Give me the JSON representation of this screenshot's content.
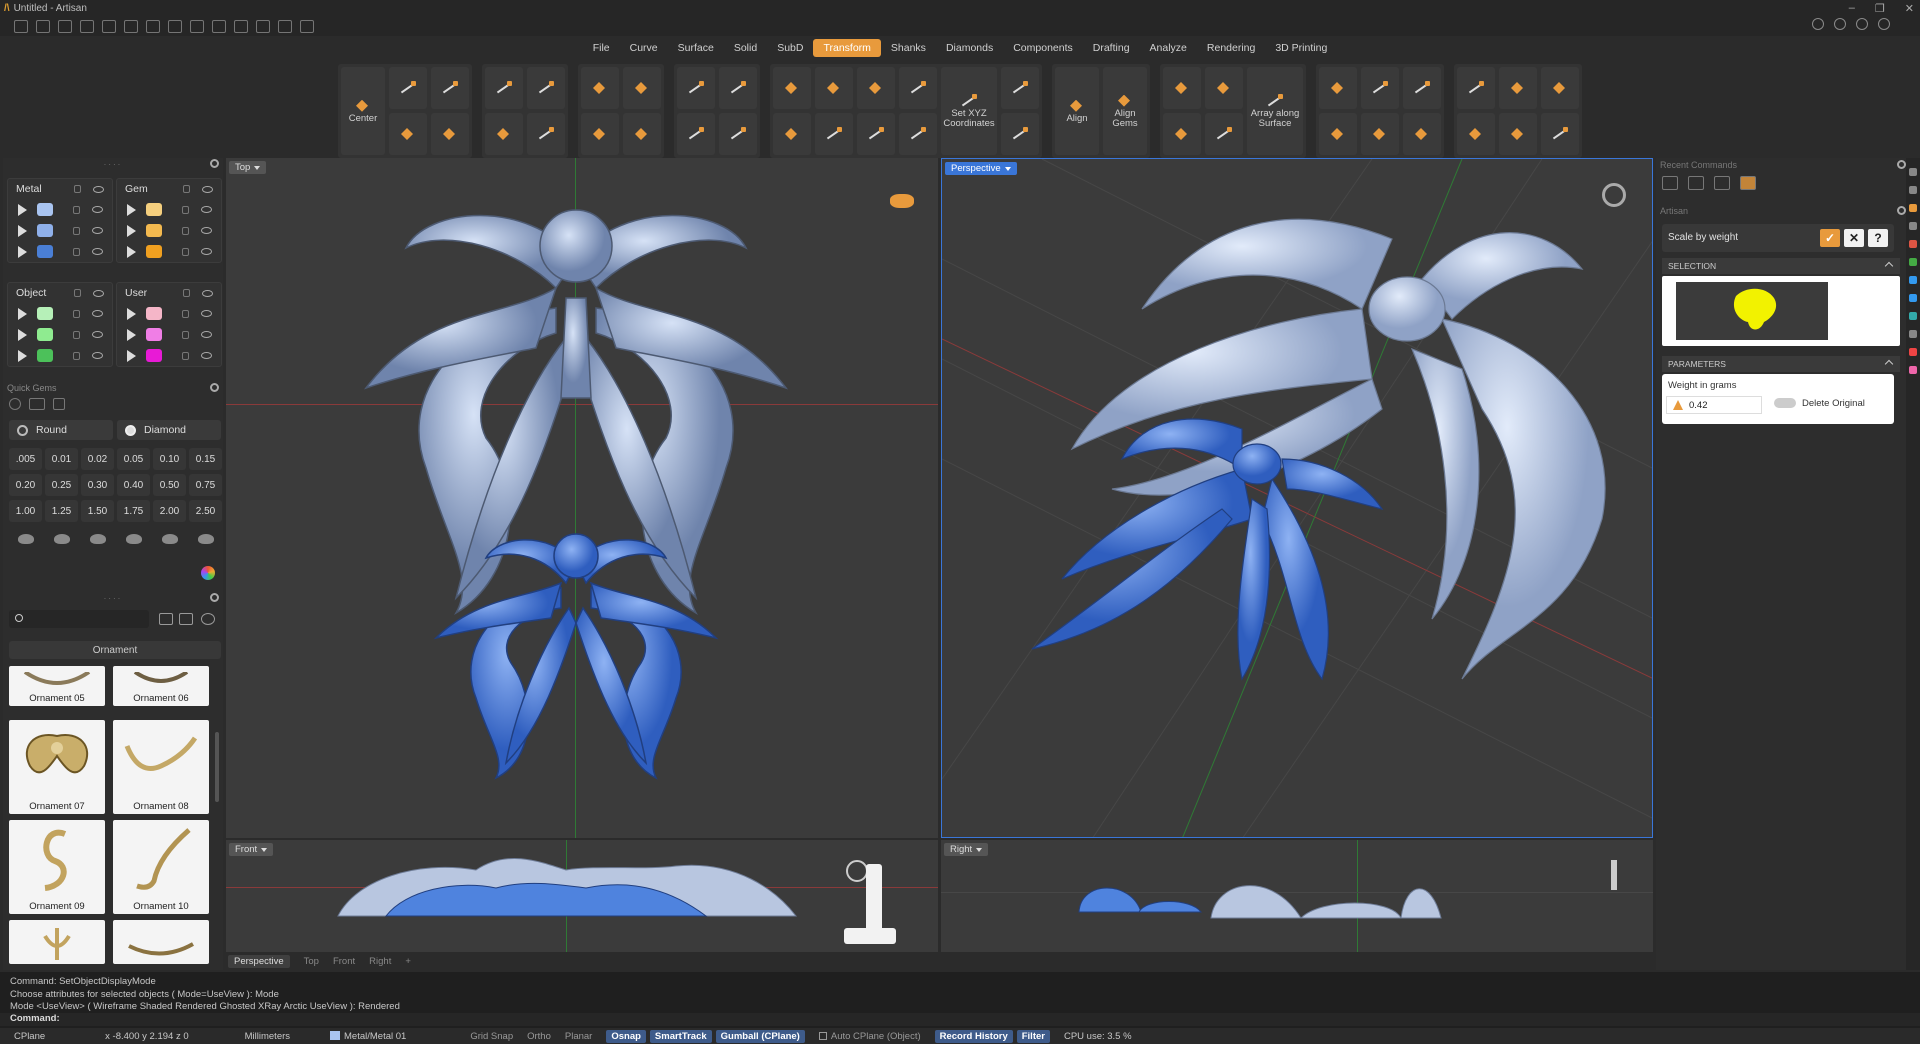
{
  "window": {
    "title": "Untitled - Artisan",
    "controls": [
      "–",
      "❐",
      "✕"
    ]
  },
  "menu": {
    "items": [
      "File",
      "Curve",
      "Surface",
      "Solid",
      "SubD",
      "Transform",
      "Shanks",
      "Diamonds",
      "Components",
      "Drafting",
      "Analyze",
      "Rendering",
      "3D Printing"
    ],
    "active": "Transform"
  },
  "ribbon": {
    "center_label": "Center",
    "set_xyz_label": "Set XYZ Coordinates",
    "align_label": "Align",
    "align_gems_label": "Align Gems",
    "array_label": "Array along Surface"
  },
  "layers": {
    "groups": [
      {
        "name": "Metal",
        "colors": [
          "#a9c4f0",
          "#8fb0ea",
          "#4a7fd6"
        ]
      },
      {
        "name": "Gem",
        "colors": [
          "#f5cf7e",
          "#f3b94f",
          "#f0a020"
        ]
      },
      {
        "name": "Object",
        "colors": [
          "#b6f0b8",
          "#8feb90",
          "#4cc15a"
        ]
      },
      {
        "name": "User",
        "colors": [
          "#f5b6c8",
          "#f07ee6",
          "#e81ad6"
        ]
      }
    ]
  },
  "quick_gems": {
    "title": "Quick Gems",
    "shape": "Round",
    "cut": "Diamond",
    "sizes": [
      ".005",
      "0.01",
      "0.02",
      "0.05",
      "0.10",
      "0.15",
      "0.20",
      "0.25",
      "0.30",
      "0.40",
      "0.50",
      "0.75",
      "1.00",
      "1.25",
      "1.50",
      "1.75",
      "2.00",
      "2.50"
    ]
  },
  "library": {
    "category": "Ornament",
    "items": [
      "Ornament 05",
      "Ornament 06",
      "Ornament 07",
      "Ornament 08",
      "Ornament 09",
      "Ornament 10"
    ]
  },
  "viewports": {
    "top": "Top",
    "perspective": "Perspective",
    "front": "Front",
    "right": "Right"
  },
  "viewport_tabs": [
    "Perspective",
    "Top",
    "Front",
    "Right"
  ],
  "right_panel": {
    "recent_commands": "Recent Commands",
    "artisan_label": "Artisan",
    "command_name": "Scale by weight",
    "selection_header": "SELECTION",
    "parameters_header": "PARAMETERS",
    "weight_label": "Weight in grams",
    "weight_value": "0.42",
    "delete_original_label": "Delete Original",
    "ok_symbol": "✓",
    "cancel_symbol": "✕",
    "help_symbol": "?"
  },
  "command_history": [
    "Command: SetObjectDisplayMode",
    "Choose attributes for selected objects ( Mode=UseView ): Mode",
    "Mode <UseView> ( Wireframe  Shaded  Rendered  Ghosted  XRay  Arctic  UseView ): Rendered"
  ],
  "command_prompt": "Command:",
  "status": {
    "cplane": "CPlane",
    "coords": "x -8.400  y 2.194  z 0",
    "units": "Millimeters",
    "layer": "Metal/Metal 01",
    "toggles": [
      "Grid Snap",
      "Ortho",
      "Planar",
      "Osnap",
      "SmartTrack",
      "Gumball (CPlane)",
      "Auto CPlane (Object)",
      "Record History",
      "Filter"
    ],
    "cpu": "CPU use: 3.5 %"
  }
}
